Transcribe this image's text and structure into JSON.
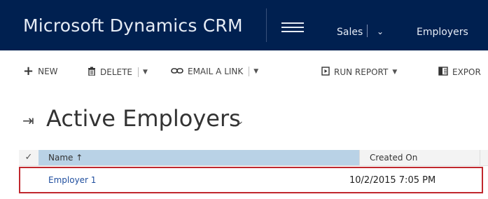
{
  "header": {
    "app_title": "Microsoft Dynamics CRM",
    "nav_area": "Sales",
    "nav_entity": "Employers",
    "menu_icon": "hamburger-icon",
    "chevron_icon": "chevron-down-icon",
    "background_color": "#002050"
  },
  "commands": {
    "new_label": "NEW",
    "delete_label": "DELETE",
    "email_link_label": "EMAIL A LINK",
    "run_report_label": "RUN REPORT",
    "export_label": "EXPOR",
    "icons": {
      "new": "plus-icon",
      "delete": "trash-icon",
      "email_link": "link-icon",
      "run_report": "report-icon",
      "export": "excel-icon"
    }
  },
  "view": {
    "title": "Active Employers",
    "pin_icon": "pin-icon",
    "chevron_icon": "chevron-down-icon"
  },
  "grid": {
    "columns": [
      {
        "label": "Name ↑",
        "sorted": "ascending"
      },
      {
        "label": "Created On"
      }
    ],
    "rows": [
      {
        "name": "Employer 1",
        "created_on": "10/2/2015 7:05 PM"
      }
    ],
    "highlight_color": "#c0282e"
  }
}
